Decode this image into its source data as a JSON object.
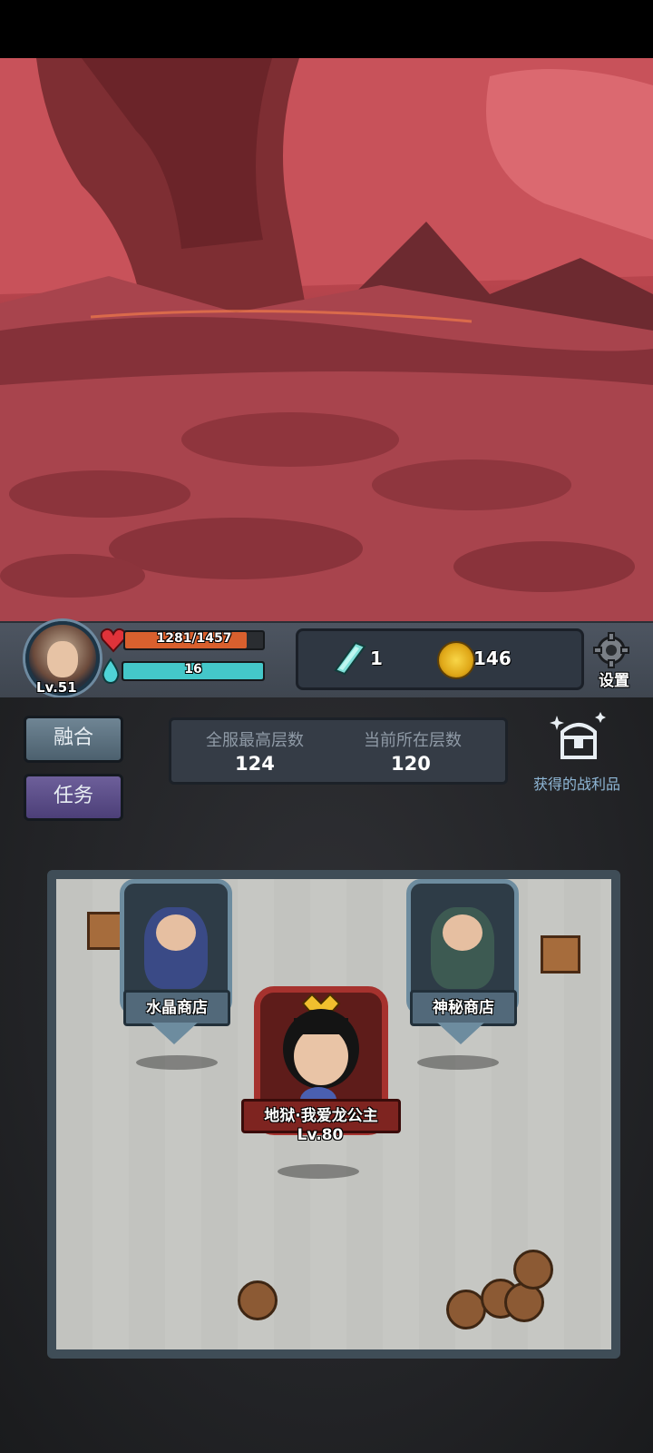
{
  "player": {
    "level": "Lv.51",
    "hp_text": "1281/1457",
    "hp_ratio": 0.879,
    "mp_text": "16",
    "mp_ratio": 1.0
  },
  "currency": {
    "crystal_count": "1",
    "coin_count": "146"
  },
  "settings": {
    "label": "设置"
  },
  "side_buttons": {
    "merge": "融合",
    "task": "任务"
  },
  "floors": {
    "server_max_label": "全服最高层数",
    "server_max_value": "124",
    "current_label": "当前所在层数",
    "current_value": "120"
  },
  "loot": {
    "label": "获得的战利品"
  },
  "npcs": [
    {
      "name": "水晶商店"
    },
    {
      "name": "神秘商店"
    }
  ],
  "boss": {
    "name": "地狱·我爱龙公主",
    "level": "Lv.80"
  },
  "colors": {
    "hp": "#d9602e",
    "mp": "#44c7c9",
    "boss_frame": "#a6322e",
    "npc_frame": "#6d8c9f"
  }
}
